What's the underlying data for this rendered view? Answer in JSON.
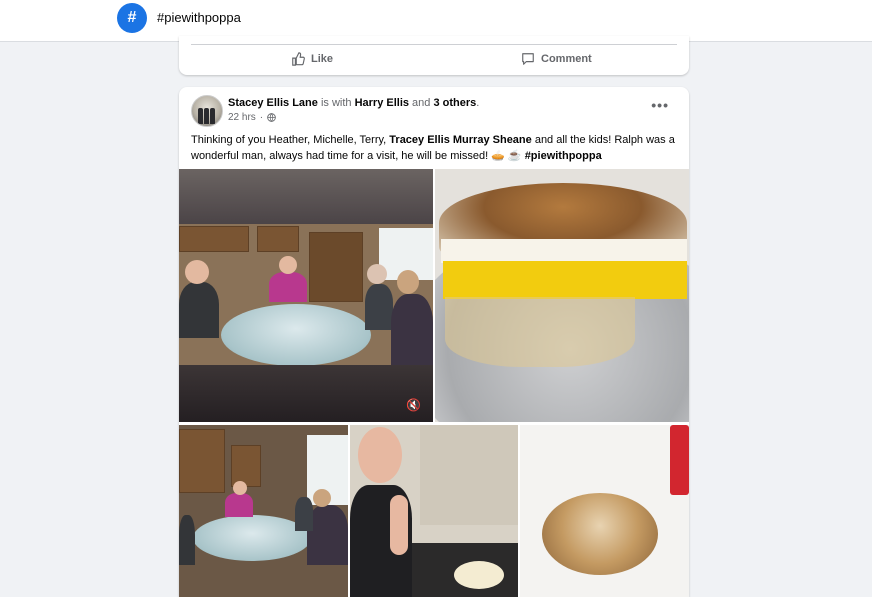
{
  "header": {
    "hashtag_icon_glyph": "#",
    "hashtag": "#piewithpoppa"
  },
  "prev_post": {
    "like_label": "Like",
    "comment_label": "Comment"
  },
  "post": {
    "author": "Stacey Ellis Lane",
    "with_text": " is with ",
    "tagged": "Harry Ellis",
    "and_text": " and ",
    "others": "3 others",
    "period": ".",
    "time": "22 hrs",
    "dot": "·",
    "privacy_icon": "globe-icon",
    "more_label": "•••",
    "text_part1": "Thinking of you Heather, Michelle, Terry, ",
    "text_bold": "Tracey Ellis Murray Sheane",
    "text_part2": " and all the kids! Ralph was a wonderful man, always had time for a visit, he will be missed! 🥧 ☕ ",
    "text_hashtag": "#piewithpoppa",
    "video_mute_icon": "🔇"
  },
  "colors": {
    "accent": "#1b74e4",
    "muted_text": "#65676b",
    "background": "#f0f2f5"
  }
}
